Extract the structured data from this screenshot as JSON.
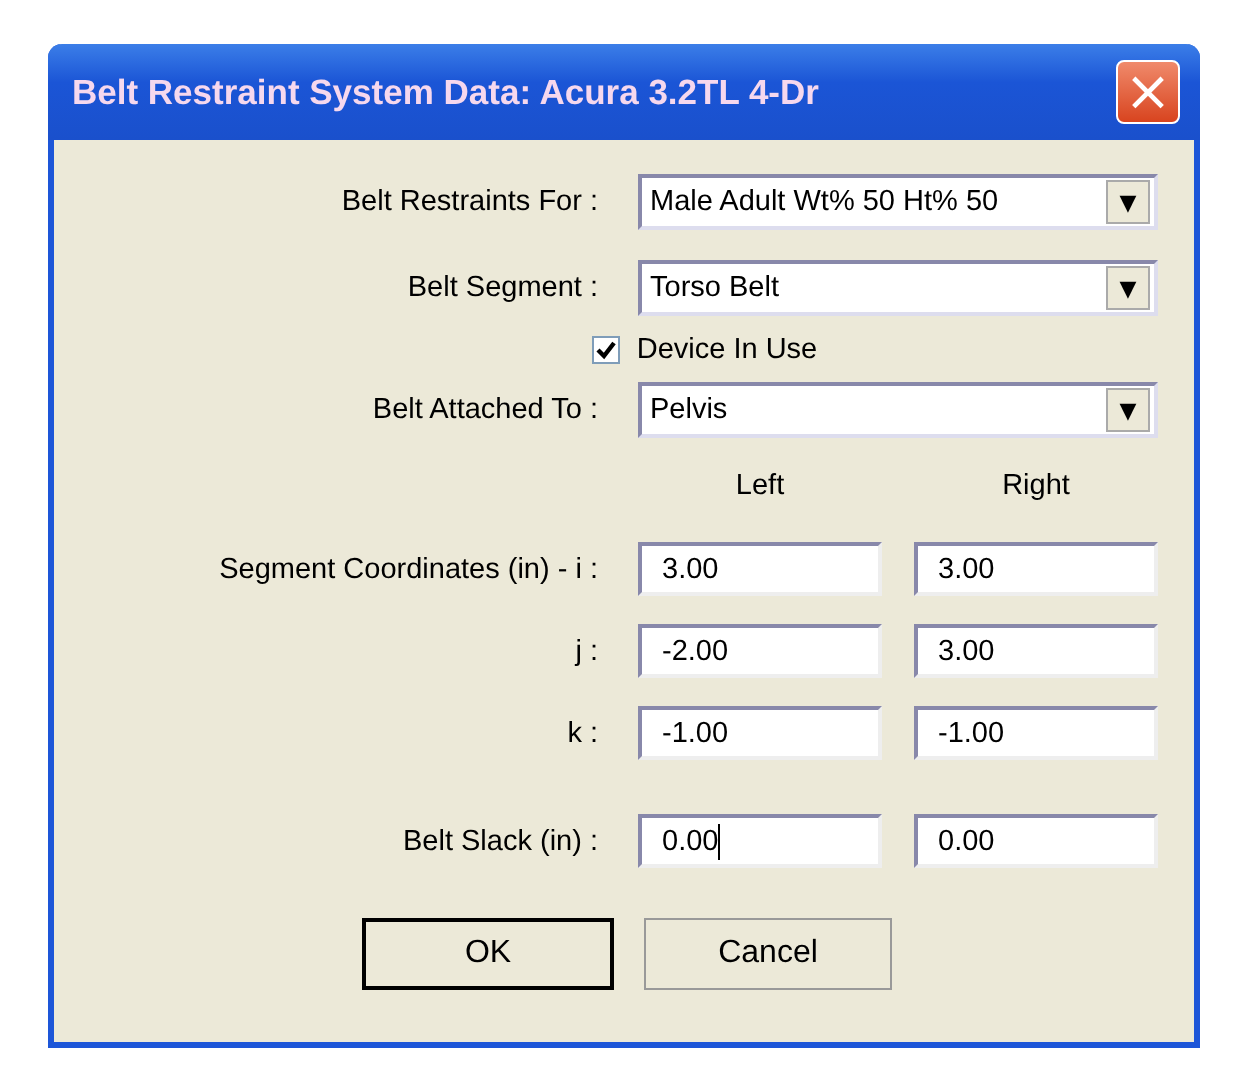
{
  "window": {
    "title": "Belt Restraint System Data: Acura 3.2TL 4-Dr",
    "close": "×"
  },
  "dropdowns": [
    {
      "label": "Belt Restraints For :",
      "value": "Male Adult Wt% 50 Ht% 50",
      "arrow": "▼"
    },
    {
      "label": "Belt Segment :",
      "value": "Torso Belt",
      "arrow": "▼"
    }
  ],
  "device_in_use": {
    "label": "Device In Use",
    "checked": true
  },
  "attached": {
    "label": "Belt Attached To :",
    "value": "Pelvis",
    "arrow": "▼"
  },
  "columns": [
    "Left",
    "Right"
  ],
  "coordinates": [
    {
      "label": "Segment Coordinates  (in) - i :",
      "left": {
        "value": "3.00",
        "focused": false
      },
      "right": {
        "value": "3.00",
        "focused": false
      }
    },
    {
      "label": "j :",
      "left": {
        "value": "-2.00",
        "focused": false
      },
      "right": {
        "value": "3.00",
        "focused": false
      }
    },
    {
      "label": "k :",
      "left": {
        "value": "-1.00",
        "focused": false
      },
      "right": {
        "value": "-1.00",
        "focused": false
      }
    }
  ],
  "slack": {
    "label": "Belt Slack  (in) :",
    "left": {
      "value": "0.00",
      "focused": true
    },
    "right": {
      "value": "0.00",
      "focused": false
    }
  },
  "buttons": [
    {
      "label": "OK",
      "default": true
    },
    {
      "label": "Cancel",
      "default": false
    }
  ]
}
